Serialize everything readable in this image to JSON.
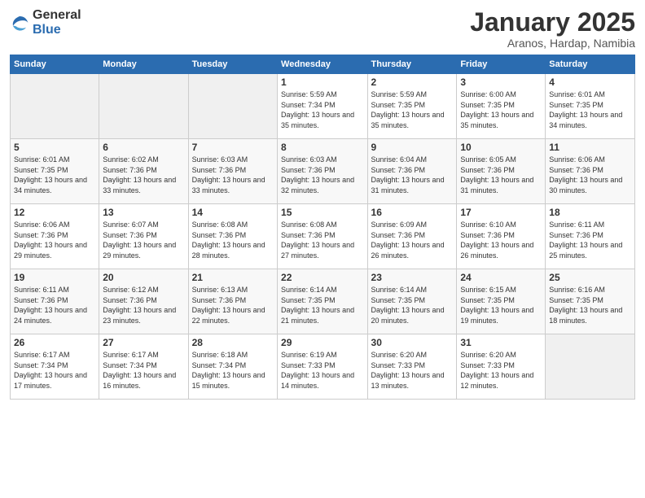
{
  "logo": {
    "general": "General",
    "blue": "Blue"
  },
  "header": {
    "month": "January 2025",
    "location": "Aranos, Hardap, Namibia"
  },
  "weekdays": [
    "Sunday",
    "Monday",
    "Tuesday",
    "Wednesday",
    "Thursday",
    "Friday",
    "Saturday"
  ],
  "weeks": [
    [
      {
        "day": "",
        "sunrise": "",
        "sunset": "",
        "daylight": ""
      },
      {
        "day": "",
        "sunrise": "",
        "sunset": "",
        "daylight": ""
      },
      {
        "day": "",
        "sunrise": "",
        "sunset": "",
        "daylight": ""
      },
      {
        "day": "1",
        "sunrise": "Sunrise: 5:59 AM",
        "sunset": "Sunset: 7:34 PM",
        "daylight": "Daylight: 13 hours and 35 minutes."
      },
      {
        "day": "2",
        "sunrise": "Sunrise: 5:59 AM",
        "sunset": "Sunset: 7:35 PM",
        "daylight": "Daylight: 13 hours and 35 minutes."
      },
      {
        "day": "3",
        "sunrise": "Sunrise: 6:00 AM",
        "sunset": "Sunset: 7:35 PM",
        "daylight": "Daylight: 13 hours and 35 minutes."
      },
      {
        "day": "4",
        "sunrise": "Sunrise: 6:01 AM",
        "sunset": "Sunset: 7:35 PM",
        "daylight": "Daylight: 13 hours and 34 minutes."
      }
    ],
    [
      {
        "day": "5",
        "sunrise": "Sunrise: 6:01 AM",
        "sunset": "Sunset: 7:35 PM",
        "daylight": "Daylight: 13 hours and 34 minutes."
      },
      {
        "day": "6",
        "sunrise": "Sunrise: 6:02 AM",
        "sunset": "Sunset: 7:36 PM",
        "daylight": "Daylight: 13 hours and 33 minutes."
      },
      {
        "day": "7",
        "sunrise": "Sunrise: 6:03 AM",
        "sunset": "Sunset: 7:36 PM",
        "daylight": "Daylight: 13 hours and 33 minutes."
      },
      {
        "day": "8",
        "sunrise": "Sunrise: 6:03 AM",
        "sunset": "Sunset: 7:36 PM",
        "daylight": "Daylight: 13 hours and 32 minutes."
      },
      {
        "day": "9",
        "sunrise": "Sunrise: 6:04 AM",
        "sunset": "Sunset: 7:36 PM",
        "daylight": "Daylight: 13 hours and 31 minutes."
      },
      {
        "day": "10",
        "sunrise": "Sunrise: 6:05 AM",
        "sunset": "Sunset: 7:36 PM",
        "daylight": "Daylight: 13 hours and 31 minutes."
      },
      {
        "day": "11",
        "sunrise": "Sunrise: 6:06 AM",
        "sunset": "Sunset: 7:36 PM",
        "daylight": "Daylight: 13 hours and 30 minutes."
      }
    ],
    [
      {
        "day": "12",
        "sunrise": "Sunrise: 6:06 AM",
        "sunset": "Sunset: 7:36 PM",
        "daylight": "Daylight: 13 hours and 29 minutes."
      },
      {
        "day": "13",
        "sunrise": "Sunrise: 6:07 AM",
        "sunset": "Sunset: 7:36 PM",
        "daylight": "Daylight: 13 hours and 29 minutes."
      },
      {
        "day": "14",
        "sunrise": "Sunrise: 6:08 AM",
        "sunset": "Sunset: 7:36 PM",
        "daylight": "Daylight: 13 hours and 28 minutes."
      },
      {
        "day": "15",
        "sunrise": "Sunrise: 6:08 AM",
        "sunset": "Sunset: 7:36 PM",
        "daylight": "Daylight: 13 hours and 27 minutes."
      },
      {
        "day": "16",
        "sunrise": "Sunrise: 6:09 AM",
        "sunset": "Sunset: 7:36 PM",
        "daylight": "Daylight: 13 hours and 26 minutes."
      },
      {
        "day": "17",
        "sunrise": "Sunrise: 6:10 AM",
        "sunset": "Sunset: 7:36 PM",
        "daylight": "Daylight: 13 hours and 26 minutes."
      },
      {
        "day": "18",
        "sunrise": "Sunrise: 6:11 AM",
        "sunset": "Sunset: 7:36 PM",
        "daylight": "Daylight: 13 hours and 25 minutes."
      }
    ],
    [
      {
        "day": "19",
        "sunrise": "Sunrise: 6:11 AM",
        "sunset": "Sunset: 7:36 PM",
        "daylight": "Daylight: 13 hours and 24 minutes."
      },
      {
        "day": "20",
        "sunrise": "Sunrise: 6:12 AM",
        "sunset": "Sunset: 7:36 PM",
        "daylight": "Daylight: 13 hours and 23 minutes."
      },
      {
        "day": "21",
        "sunrise": "Sunrise: 6:13 AM",
        "sunset": "Sunset: 7:36 PM",
        "daylight": "Daylight: 13 hours and 22 minutes."
      },
      {
        "day": "22",
        "sunrise": "Sunrise: 6:14 AM",
        "sunset": "Sunset: 7:35 PM",
        "daylight": "Daylight: 13 hours and 21 minutes."
      },
      {
        "day": "23",
        "sunrise": "Sunrise: 6:14 AM",
        "sunset": "Sunset: 7:35 PM",
        "daylight": "Daylight: 13 hours and 20 minutes."
      },
      {
        "day": "24",
        "sunrise": "Sunrise: 6:15 AM",
        "sunset": "Sunset: 7:35 PM",
        "daylight": "Daylight: 13 hours and 19 minutes."
      },
      {
        "day": "25",
        "sunrise": "Sunrise: 6:16 AM",
        "sunset": "Sunset: 7:35 PM",
        "daylight": "Daylight: 13 hours and 18 minutes."
      }
    ],
    [
      {
        "day": "26",
        "sunrise": "Sunrise: 6:17 AM",
        "sunset": "Sunset: 7:34 PM",
        "daylight": "Daylight: 13 hours and 17 minutes."
      },
      {
        "day": "27",
        "sunrise": "Sunrise: 6:17 AM",
        "sunset": "Sunset: 7:34 PM",
        "daylight": "Daylight: 13 hours and 16 minutes."
      },
      {
        "day": "28",
        "sunrise": "Sunrise: 6:18 AM",
        "sunset": "Sunset: 7:34 PM",
        "daylight": "Daylight: 13 hours and 15 minutes."
      },
      {
        "day": "29",
        "sunrise": "Sunrise: 6:19 AM",
        "sunset": "Sunset: 7:33 PM",
        "daylight": "Daylight: 13 hours and 14 minutes."
      },
      {
        "day": "30",
        "sunrise": "Sunrise: 6:20 AM",
        "sunset": "Sunset: 7:33 PM",
        "daylight": "Daylight: 13 hours and 13 minutes."
      },
      {
        "day": "31",
        "sunrise": "Sunrise: 6:20 AM",
        "sunset": "Sunset: 7:33 PM",
        "daylight": "Daylight: 13 hours and 12 minutes."
      },
      {
        "day": "",
        "sunrise": "",
        "sunset": "",
        "daylight": ""
      }
    ]
  ]
}
